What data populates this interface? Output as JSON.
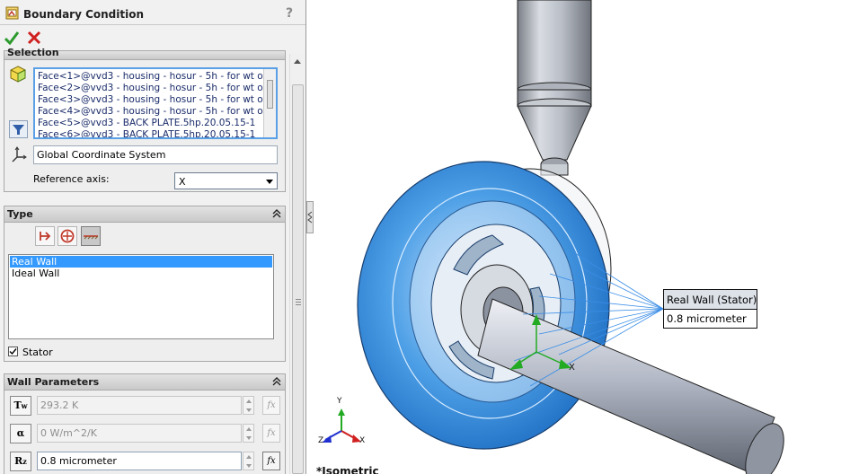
{
  "panel": {
    "title": "Boundary Condition",
    "help": "?"
  },
  "selection": {
    "header": "Selection",
    "faces": [
      "Face<1>@vvd3 - housing - hosur - 5h    - for wt o",
      "Face<2>@vvd3 - housing - hosur - 5h    - for wt o",
      "Face<3>@vvd3 - housing - hosur - 5h    - for wt o",
      "Face<4>@vvd3 - housing - hosur - 5h    - for wt o",
      "Face<5>@vvd3 - BACK PLATE.5hp.20.05.15-1",
      "Face<6>@vvd3 - BACK PLATE.5hp.20.05.15-1"
    ],
    "coordinate_system": "Global Coordinate System",
    "reference_axis_label": "Reference axis:",
    "reference_axis_value": "X"
  },
  "type": {
    "header": "Type",
    "options": [
      "Real Wall",
      "Ideal Wall"
    ],
    "selected": "Real Wall",
    "stator_label": "Stator",
    "stator_checked": true
  },
  "wall_parameters": {
    "header": "Wall Parameters",
    "temperature": "293.2 K",
    "heat_transfer": "0 W/m^2/K",
    "roughness": "0.8 micrometer",
    "fx": "fx"
  },
  "callout": {
    "title": "Real Wall (Stator)",
    "value": "0.8 micrometer"
  },
  "view": {
    "name": "*Isometric",
    "triad_x": "X",
    "triad_y": "Y",
    "triad_z": "Z"
  },
  "colors": {
    "accent_blue": "#3399ff",
    "selection_highlight": "#3c7fdc"
  }
}
